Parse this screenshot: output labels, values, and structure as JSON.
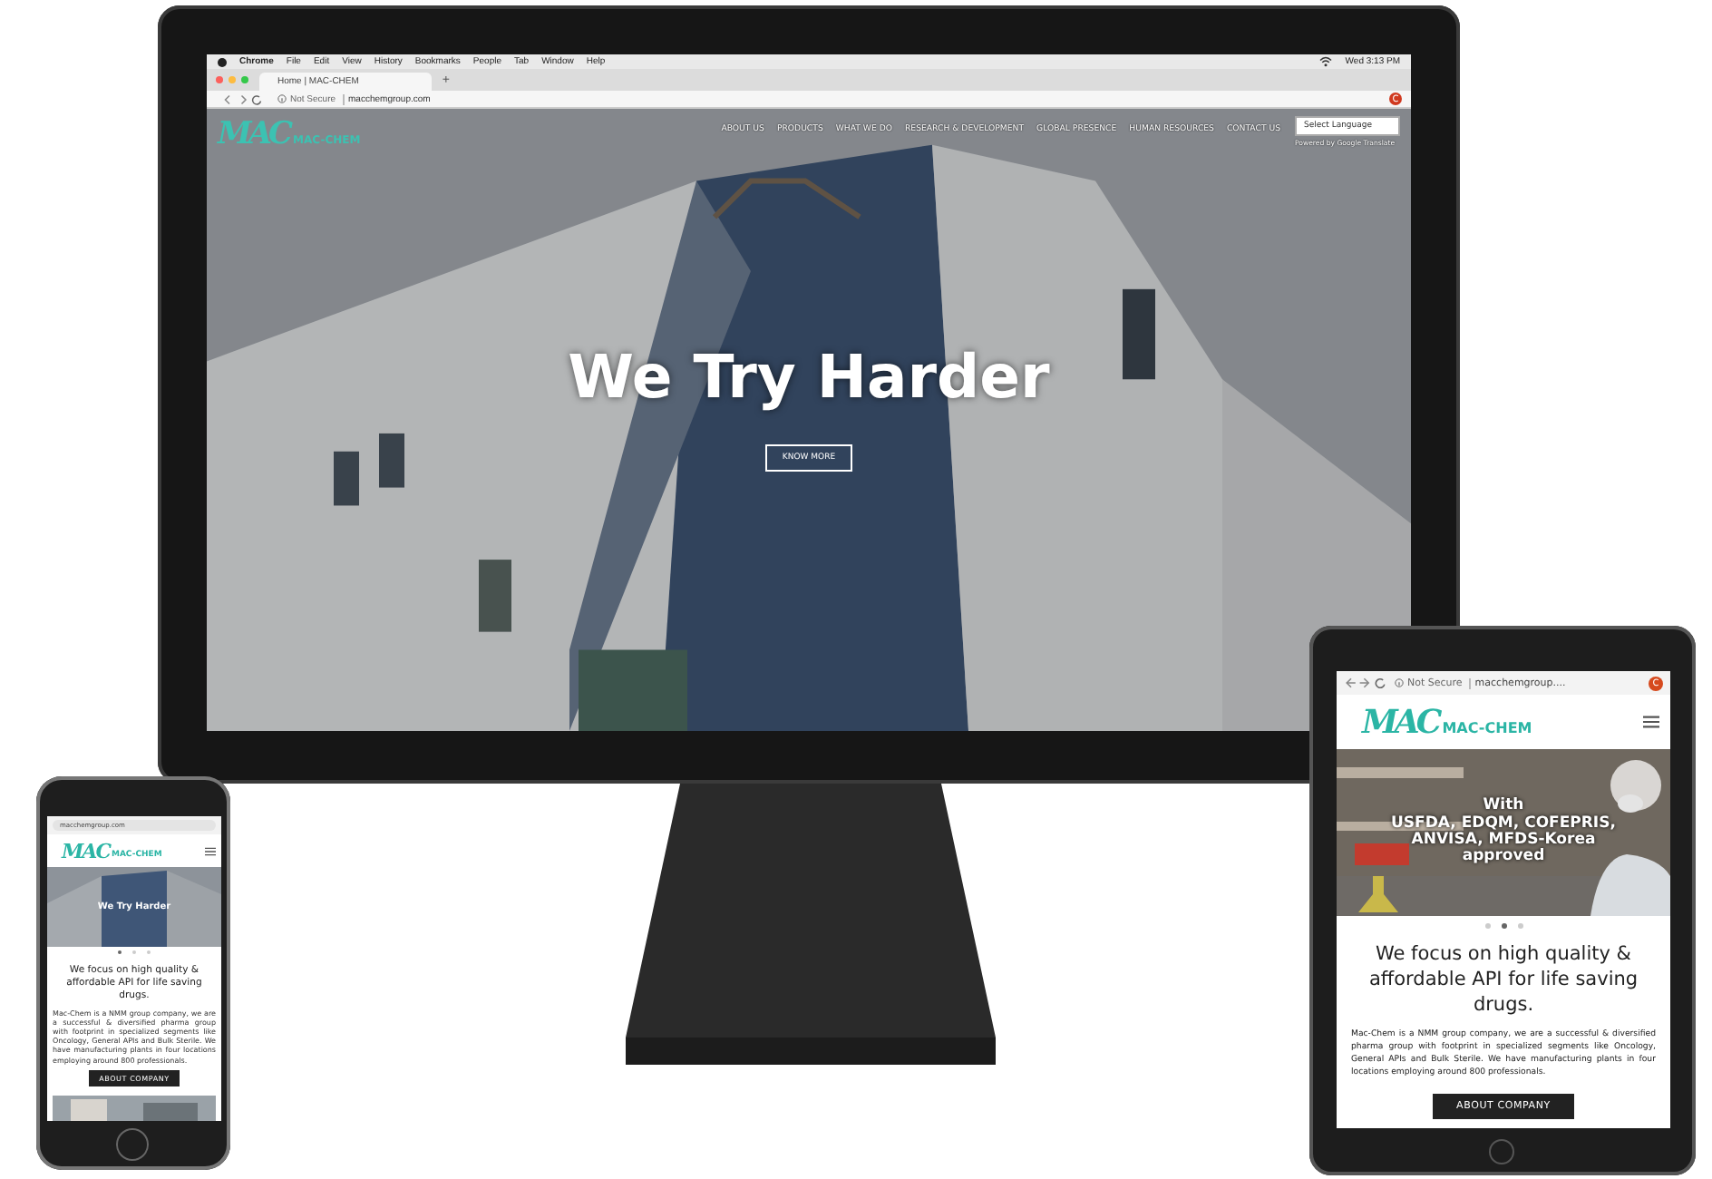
{
  "desktop": {
    "menu_bar": {
      "app": "Chrome",
      "menus": [
        "File",
        "Edit",
        "View",
        "History",
        "Bookmarks",
        "People",
        "Tab",
        "Window",
        "Help"
      ],
      "clock": "Wed 3:13 PM"
    },
    "tab": {
      "title": "Home | MAC-CHEM",
      "new_tab": "+"
    },
    "address_bar": {
      "security": "Not Secure",
      "url": "macchemgroup.com",
      "avatar_initial": "C"
    },
    "site": {
      "logo_mark": "MAC",
      "logo_text": "MAC-CHEM",
      "nav": [
        {
          "label": "ABOUT US"
        },
        {
          "label": "PRODUCTS"
        },
        {
          "label": "WHAT WE DO"
        },
        {
          "label": "RESEARCH & DEVELOPMENT"
        },
        {
          "label": "GLOBAL PRESENCE"
        },
        {
          "label": "HUMAN RESOURCES"
        },
        {
          "label": "CONTACT US"
        }
      ],
      "language_select": "Select Language",
      "translate_note": "Powered by Google Translate",
      "hero_title": "We Try Harder",
      "hero_button": "KNOW MORE"
    }
  },
  "tablet": {
    "address_bar": {
      "security": "Not Secure",
      "url": "macchemgroup....",
      "avatar_initial": "C"
    },
    "logo_mark": "MAC",
    "logo_text": "MAC-CHEM",
    "slide_caption": [
      "With",
      "USFDA, EDQM, COFEPRIS,",
      "ANVISA, MFDS-Korea",
      "approved"
    ],
    "slides": [
      {
        "selected": false
      },
      {
        "selected": true
      },
      {
        "selected": false
      }
    ],
    "headline": "We focus on high quality & affordable API for life saving drugs.",
    "paragraph": "Mac-Chem is a NMM group company, we are a successful & diversified pharma group with footprint in specialized segments like Oncology, General APIs and Bulk Sterile. We have manufacturing plants in four locations employing around 800 professionals.",
    "button": "ABOUT COMPANY"
  },
  "phone": {
    "address_bar": {
      "url": "macchemgroup.com"
    },
    "logo_mark": "MAC",
    "logo_text": "MAC-CHEM",
    "slide_caption": "We Try Harder",
    "slides": [
      {
        "selected": true
      },
      {
        "selected": false
      },
      {
        "selected": false
      }
    ],
    "headline": "We focus on high quality & affordable API for life saving drugs.",
    "paragraph": "Mac-Chem is a NMM group company, we are a successful & diversified pharma group with footprint in specialized segments like Oncology, General APIs and Bulk Sterile. We have manufacturing plants in four locations employing around 800 professionals.",
    "button": "ABOUT COMPANY"
  }
}
